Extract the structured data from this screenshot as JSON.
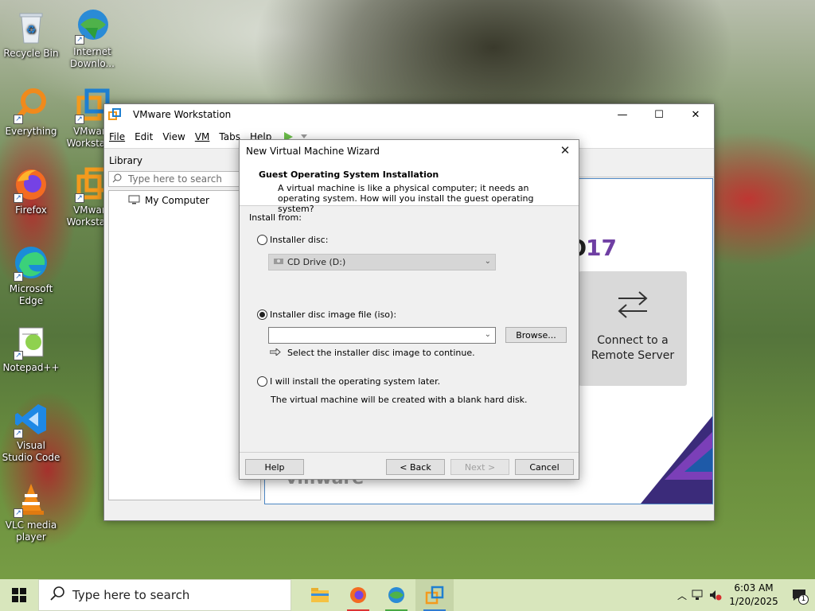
{
  "desktop": {
    "icons": [
      {
        "label": "Recycle Bin"
      },
      {
        "label": "Internet Downlo..."
      },
      {
        "label": "Everything"
      },
      {
        "label": "VMware Workstat..."
      },
      {
        "label": "Firefox"
      },
      {
        "label": "VMware Workstat..."
      },
      {
        "label": "Microsoft Edge"
      },
      {
        "label": "Notepad++"
      },
      {
        "label": "Visual Studio Code"
      },
      {
        "label": "VLC media player"
      }
    ]
  },
  "vmware": {
    "title": "VMware Workstation",
    "menu": {
      "file": "File",
      "edit": "Edit",
      "view": "View",
      "vm": "VM",
      "tabs": "Tabs",
      "help": "Help"
    },
    "library": {
      "title": "Library",
      "search_placeholder": "Type here to search",
      "tree_item": "My Computer"
    },
    "home": {
      "version_suffix": "17",
      "version_prefix": "O",
      "remote_card_label": "Connect to a Remote Server",
      "watermark": "vmware"
    }
  },
  "wizard": {
    "title": "New Virtual Machine Wizard",
    "heading": "Guest Operating System Installation",
    "description": "A virtual machine is like a physical computer; it needs an operating system. How will you install the guest operating system?",
    "install_from_label": "Install from:",
    "option_disc": "Installer disc:",
    "disc_selected": "CD Drive (D:)",
    "option_iso": "Installer disc image file (iso):",
    "iso_value": "",
    "browse_label": "Browse...",
    "iso_hint": "Select the installer disc image to continue.",
    "option_later": "I will install the operating system later.",
    "later_hint": "The virtual machine will be created with a blank hard disk.",
    "selected_option": "iso",
    "buttons": {
      "help": "Help",
      "back": "< Back",
      "next": "Next >",
      "cancel": "Cancel"
    }
  },
  "taskbar": {
    "search_placeholder": "Type here to search",
    "time": "6:03 AM",
    "date": "1/20/2025",
    "notification_count": "1"
  }
}
